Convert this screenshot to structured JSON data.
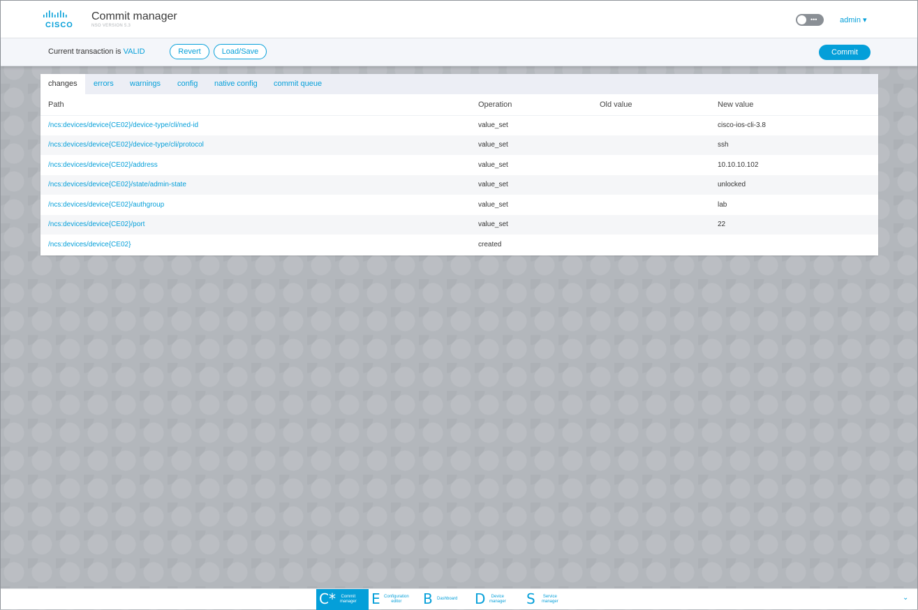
{
  "header": {
    "logo_text": "CISCO",
    "title": "Commit manager",
    "version": "NSO VERSION 5.3",
    "toggle_dots": "•••",
    "user": "admin ▾"
  },
  "transaction": {
    "status_prefix": "Current transaction is ",
    "status_value": "VALID",
    "revert_label": "Revert",
    "load_save_label": "Load/Save",
    "commit_label": "Commit"
  },
  "tabs": [
    {
      "label": "changes",
      "active": true
    },
    {
      "label": "errors"
    },
    {
      "label": "warnings"
    },
    {
      "label": "config"
    },
    {
      "label": "native config"
    },
    {
      "label": "commit queue"
    }
  ],
  "table": {
    "columns": [
      "Path",
      "Operation",
      "Old value",
      "New value"
    ],
    "rows": [
      {
        "path": "/ncs:devices/device{CE02}/device-type/cli/ned-id",
        "operation": "value_set",
        "old": "",
        "new": "cisco-ios-cli-3.8"
      },
      {
        "path": "/ncs:devices/device{CE02}/device-type/cli/protocol",
        "operation": "value_set",
        "old": "",
        "new": "ssh"
      },
      {
        "path": "/ncs:devices/device{CE02}/address",
        "operation": "value_set",
        "old": "",
        "new": "10.10.10.102"
      },
      {
        "path": "/ncs:devices/device{CE02}/state/admin-state",
        "operation": "value_set",
        "old": "",
        "new": "unlocked"
      },
      {
        "path": "/ncs:devices/device{CE02}/authgroup",
        "operation": "value_set",
        "old": "",
        "new": "lab"
      },
      {
        "path": "/ncs:devices/device{CE02}/port",
        "operation": "value_set",
        "old": "",
        "new": "22"
      },
      {
        "path": "/ncs:devices/device{CE02}",
        "operation": "created",
        "old": "",
        "new": ""
      }
    ]
  },
  "dock": [
    {
      "letter": "C*",
      "line1": "Commit",
      "line2": "manager",
      "active": true
    },
    {
      "letter": "E",
      "line1": "Configuration",
      "line2": "editor"
    },
    {
      "letter": "B",
      "line1": "Dashboard",
      "line2": ""
    },
    {
      "letter": "D",
      "line1": "Device",
      "line2": "manager"
    },
    {
      "letter": "S",
      "line1": "Service",
      "line2": "manager"
    }
  ],
  "dock_chevron": "⌄",
  "colors": {
    "accent": "#049fd9",
    "background": "#b3b7bc"
  },
  "icons": {
    "logo": "cisco-logo-icon",
    "toggle": "toggle-switch-icon",
    "chevron": "chevron-down-icon"
  }
}
